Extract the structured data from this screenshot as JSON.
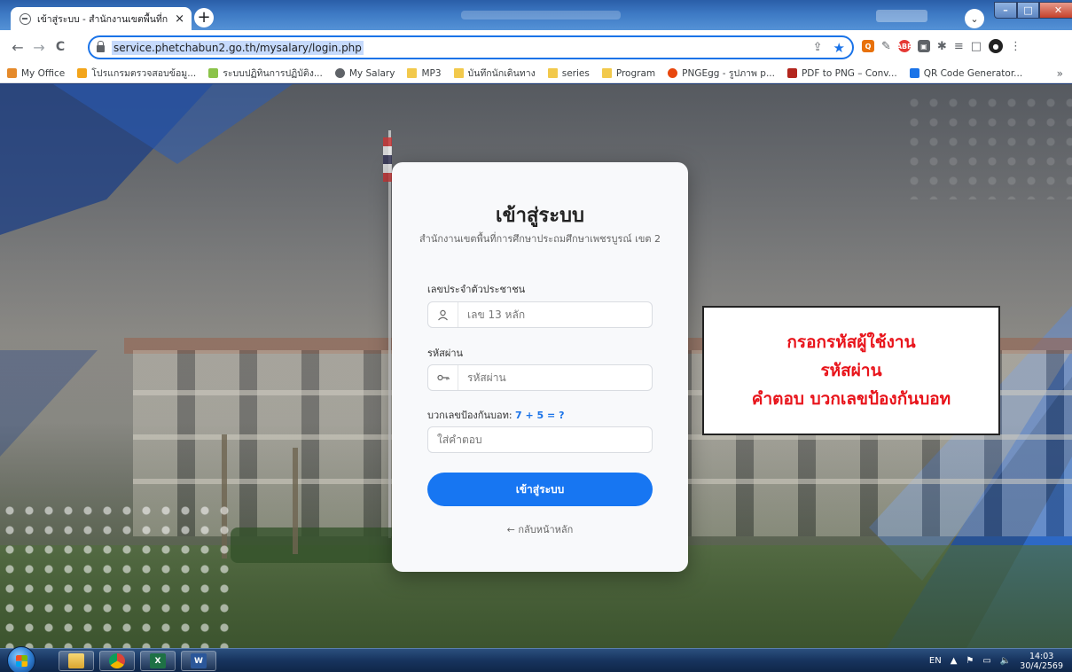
{
  "browser": {
    "tab_title": "เข้าสู่ระบบ - สำนักงานเขตพื้นที่การศึก",
    "tab_close": "×",
    "new_tab": "+",
    "profile_initial": "⌄",
    "url": "service.phetchabun2.go.th/mysalary/login.php",
    "nav": {
      "back": "←",
      "forward": "→",
      "reload": "C"
    },
    "bookmarks": [
      {
        "label": "My Office",
        "icon": "office-icon",
        "color": "#e58a2b"
      },
      {
        "label": "โปรแกรมตรวจสอบข้อมู...",
        "icon": "fire-icon",
        "color": "#f3a51b"
      },
      {
        "label": "ระบบปฏิทินการปฏิบัติง...",
        "icon": "chart-icon",
        "color": "#8bc34a"
      },
      {
        "label": "My Salary",
        "icon": "globe-icon",
        "color": "#5f6368"
      },
      {
        "label": "MP3",
        "icon": "folder-icon",
        "color": "#f2c94c"
      },
      {
        "label": "บันทึกนักเดินทาง",
        "icon": "folder-icon",
        "color": "#f2c94c"
      },
      {
        "label": "series",
        "icon": "folder-icon",
        "color": "#f2c94c"
      },
      {
        "label": "Program",
        "icon": "folder-icon",
        "color": "#f2c94c"
      },
      {
        "label": "PNGEgg - รูปภาพ p...",
        "icon": "pngegg-icon",
        "color": "#e8470e"
      },
      {
        "label": "PDF to PNG – Conv...",
        "icon": "pdf-icon",
        "color": "#b3261e"
      },
      {
        "label": "QR Code Generator...",
        "icon": "qr-icon",
        "color": "#1a73e8"
      }
    ],
    "bookmarks_more": "»"
  },
  "login": {
    "title": "เข้าสู่ระบบ",
    "subtitle": "สำนักงานเขตพื้นที่การศึกษาประถมศึกษาเพชรบูรณ์ เขต 2",
    "id_label": "เลขประจำตัวประชาชน",
    "id_placeholder": "เลข 13 หลัก",
    "password_label": "รหัสผ่าน",
    "password_placeholder": "รหัสผ่าน",
    "captcha_label": "บวกเลขป้องกันบอท:",
    "captcha_question": "7 + 5 = ?",
    "captcha_placeholder": "ใส่คำตอบ",
    "submit_label": "เข้าสู่ระบบ",
    "back_link": "← กลับหน้าหลัก"
  },
  "annotation": {
    "line1": "กรอกรหัสผู้ใช้งาน",
    "line2": "รหัสผ่าน",
    "line3": "คำตอบ บวกเลขป้องกันบอท",
    "color": "#e8141b"
  },
  "taskbar": {
    "language": "EN",
    "time": "14:03",
    "date": "30/4/2569"
  }
}
